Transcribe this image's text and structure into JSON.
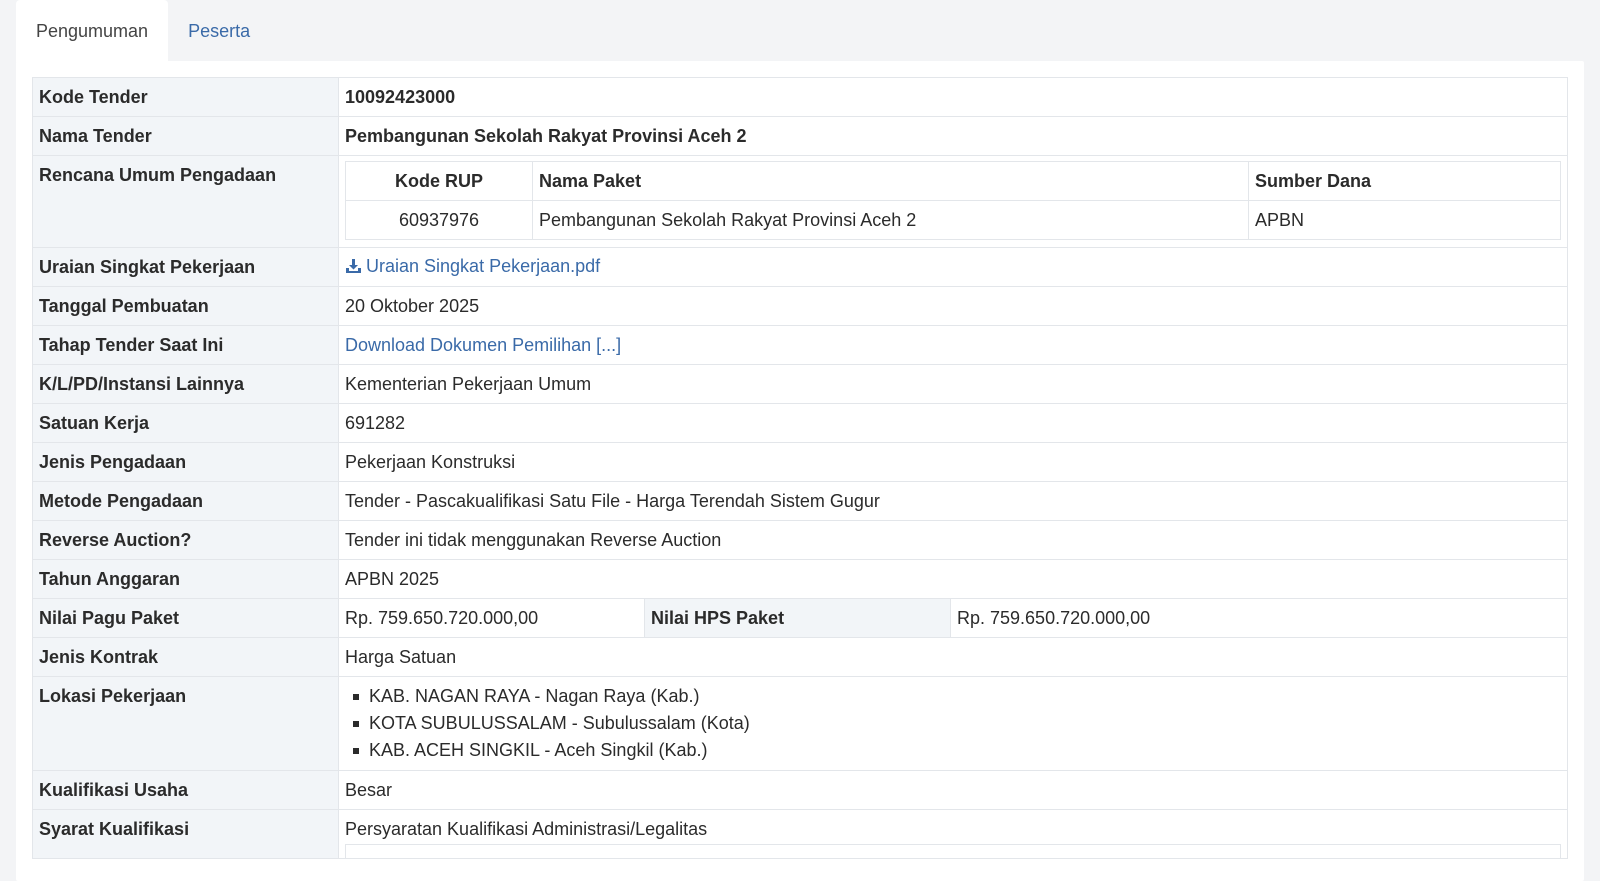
{
  "tabs": [
    {
      "label": "Pengumuman",
      "active": true
    },
    {
      "label": "Peserta",
      "active": false
    }
  ],
  "rows": {
    "kode_tender": {
      "label": "Kode Tender",
      "value": "10092423000"
    },
    "nama_tender": {
      "label": "Nama Tender",
      "value": "Pembangunan Sekolah Rakyat Provinsi Aceh 2"
    },
    "rup": {
      "label": "Rencana Umum Pengadaan",
      "headers": [
        "Kode RUP",
        "Nama Paket",
        "Sumber Dana"
      ],
      "rows": [
        {
          "kode": "60937976",
          "nama": "Pembangunan Sekolah Rakyat Provinsi Aceh 2",
          "sumber": "APBN"
        }
      ]
    },
    "uraian": {
      "label": "Uraian Singkat Pekerjaan",
      "link": "Uraian Singkat Pekerjaan.pdf",
      "icon": "download-icon"
    },
    "tanggal": {
      "label": "Tanggal Pembuatan",
      "value": "20 Oktober 2025"
    },
    "tahap": {
      "label": "Tahap Tender Saat Ini",
      "link": "Download Dokumen Pemilihan [...]"
    },
    "klpd": {
      "label": "K/L/PD/Instansi Lainnya",
      "value": "Kementerian Pekerjaan Umum"
    },
    "satker": {
      "label": "Satuan Kerja",
      "value": "691282"
    },
    "jenis_pengadaan": {
      "label": "Jenis Pengadaan",
      "value": "Pekerjaan Konstruksi"
    },
    "metode": {
      "label": "Metode Pengadaan",
      "value": "Tender - Pascakualifikasi Satu File - Harga Terendah Sistem Gugur"
    },
    "reverse": {
      "label": "Reverse Auction?",
      "value": "Tender ini tidak menggunakan Reverse Auction"
    },
    "tahun": {
      "label": "Tahun Anggaran",
      "value": "APBN 2025"
    },
    "pagu": {
      "label": "Nilai Pagu Paket",
      "value": "Rp. 759.650.720.000,00",
      "hps_label": "Nilai HPS Paket",
      "hps_value": "Rp. 759.650.720.000,00"
    },
    "kontrak": {
      "label": "Jenis Kontrak",
      "value": "Harga Satuan"
    },
    "lokasi": {
      "label": "Lokasi Pekerjaan",
      "items": [
        "KAB. NAGAN RAYA - Nagan Raya (Kab.)",
        "KOTA SUBULUSSALAM - Subulussalam (Kota)",
        "KAB. ACEH SINGKIL - Aceh Singkil (Kab.)"
      ]
    },
    "kualifikasi": {
      "label": "Kualifikasi Usaha",
      "value": "Besar"
    },
    "syarat": {
      "label": "Syarat Kualifikasi",
      "value": "Persyaratan Kualifikasi Administrasi/Legalitas"
    }
  },
  "colors": {
    "link": "#3a6aa8",
    "label_bg": "#f2f5f8",
    "border": "#e3e6ea",
    "page_bg": "#f3f4f6"
  }
}
